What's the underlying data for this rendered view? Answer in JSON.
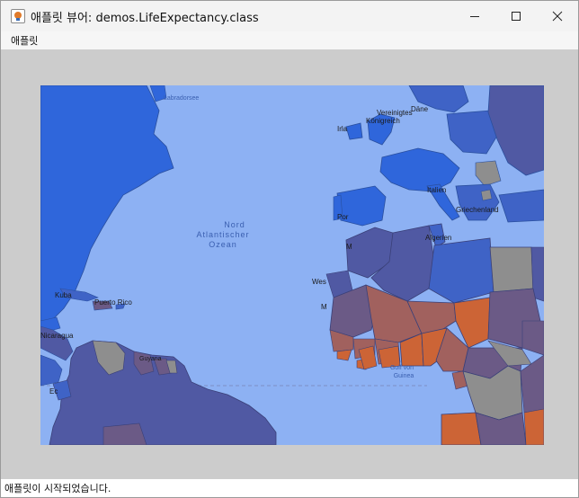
{
  "window": {
    "title": "애플릿 뷰어: demos.LifeExpectancy.class"
  },
  "menu": {
    "items": [
      {
        "label": "애플릿"
      }
    ]
  },
  "map": {
    "labels": {
      "labrador_sea": "Labradorsee",
      "ocean": [
        "Nord",
        "Atlantischer",
        "Ozean"
      ],
      "uk": [
        "Vereinigtes",
        "Königreich"
      ],
      "ireland": "Irla",
      "denmark": "Däne",
      "italy": "Italien",
      "greece": "Griechenland",
      "portugal": "Por",
      "algeria": "Algerien",
      "morocco": "M",
      "western_sahara": "Wes",
      "cuba": "Kuba",
      "puerto_rico": "Puerto Rico",
      "nicaragua": "Nicaragua",
      "ecuador": "Ec",
      "guyana": "Guyana",
      "gulf_guinea": [
        "Golf von",
        "Guinea"
      ],
      "mauritania": "M"
    },
    "colors": {
      "ocean": "#8db1f3",
      "high": "#2f66db",
      "upper": "#3f63c6",
      "mid": "#5059a3",
      "lower": "#6b5a86",
      "low": "#a1615e",
      "lowest": "#cc6436",
      "nodata": "#8e8e8e"
    }
  },
  "status": {
    "text": "애플릿이 시작되었습니다."
  }
}
